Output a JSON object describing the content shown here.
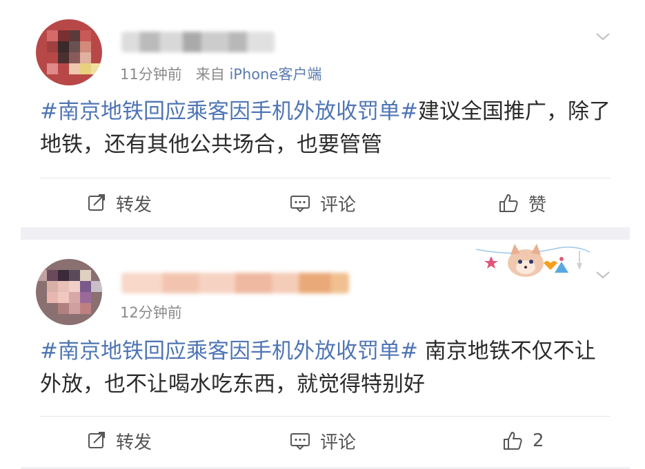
{
  "posts": [
    {
      "time": "11分钟前",
      "source_prefix": "来自",
      "source": "iPhone客户端",
      "hashtag": "#南京地铁回应乘客因手机外放收罚单#",
      "body": "建议全国推广，除了地铁，还有其他公共场合，也要管管",
      "actions": {
        "repost": "转发",
        "comment": "评论",
        "like": "赞"
      }
    },
    {
      "time": "12分钟前",
      "hashtag": "#南京地铁回应乘客因手机外放收罚单#",
      "body": " 南京地铁不仅不让外放，也不让喝水吃东西，就觉得特别好",
      "actions": {
        "repost": "转发",
        "comment": "评论",
        "like": "2"
      }
    }
  ],
  "colors": {
    "link": "#4f75b4",
    "meta": "#8a8a8a",
    "separator": "#efeff4"
  },
  "icons": [
    "chevron-down-icon",
    "repost-icon",
    "comment-icon",
    "like-icon"
  ]
}
